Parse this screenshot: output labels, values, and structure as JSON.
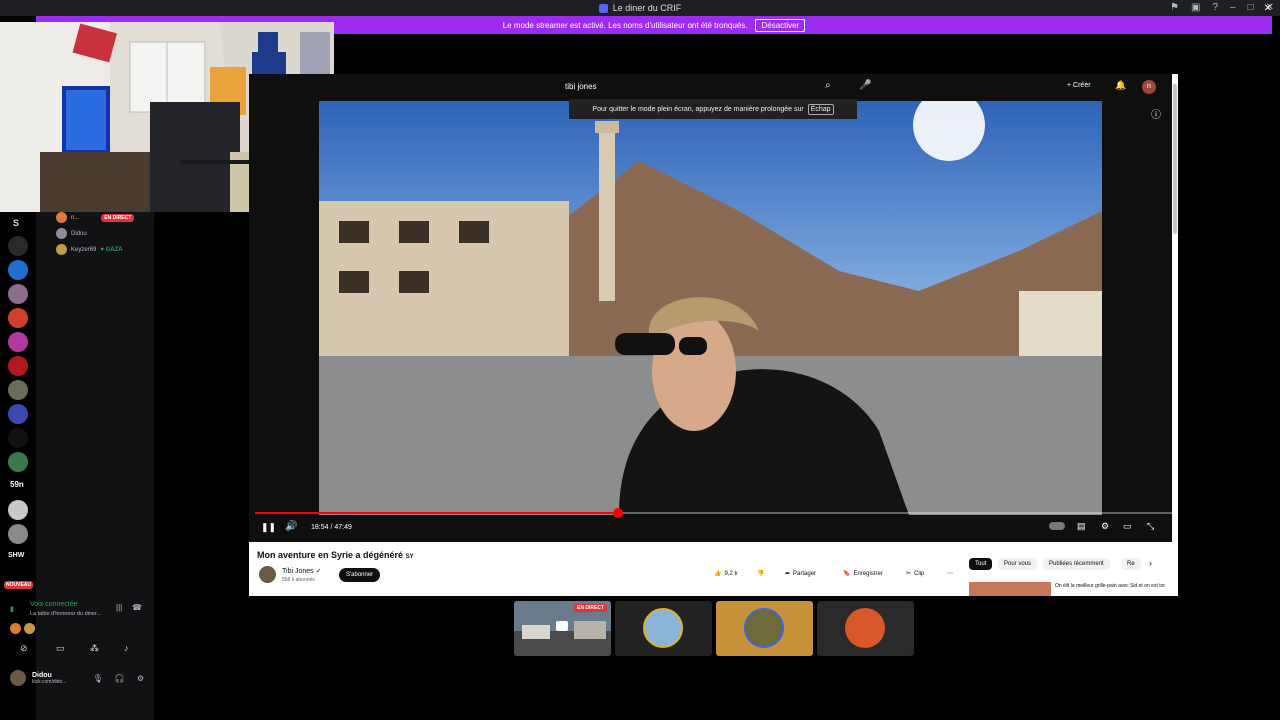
{
  "window": {
    "title": "Le diner du CRIF"
  },
  "banner": {
    "text": "Le mode streamer est activé. Les noms d'utilisateur ont été tronqués.",
    "button": "Désactiver"
  },
  "voice_users": [
    {
      "name": "n...",
      "badge": "EN DIRECT"
    },
    {
      "name": "Didou"
    },
    {
      "name": "Keyzer69",
      "tag": "GAZA"
    }
  ],
  "server_labels": {
    "s": "S",
    "n59": "59n",
    "shw": "SHW",
    "nouveau": "NOUVEAU"
  },
  "voice": {
    "status": "Voix connectée",
    "channel": "La table d'honneur du diner..."
  },
  "user": {
    "name": "Didou",
    "status": "kick.com/dido..."
  },
  "youtube": {
    "search_value": "tibi jones",
    "create_label": "Créer",
    "avatar_letter": "n",
    "tooltip": "Pour quitter le mode plein écran, appuyez de manière prolongée sur",
    "tooltip_key": "Échap",
    "time": "18:54 / 47:49",
    "progress": 0.395,
    "title": "Mon aventure en Syrie a dégénéré",
    "title_flag": "SY",
    "channel": "Tibi Jones",
    "subscribers": "558 k abonnés",
    "subscribe": "S'abonner",
    "likes": "9,2 k",
    "share": "Partager",
    "save": "Enregistrer",
    "clip": "Clip",
    "chips": [
      "Tout",
      "Pour vous",
      "Publiées récemment",
      "Re"
    ],
    "recommendation": "On élit le meilleur grille-pain avec Sid et on est tombés sur l..."
  },
  "tiles": [
    {
      "badge": "EN DIRECT"
    }
  ],
  "colors": {
    "accent": "#9b2cf0",
    "live": "#da373c",
    "yt_red": "#ff0000",
    "online": "#23a55a"
  }
}
